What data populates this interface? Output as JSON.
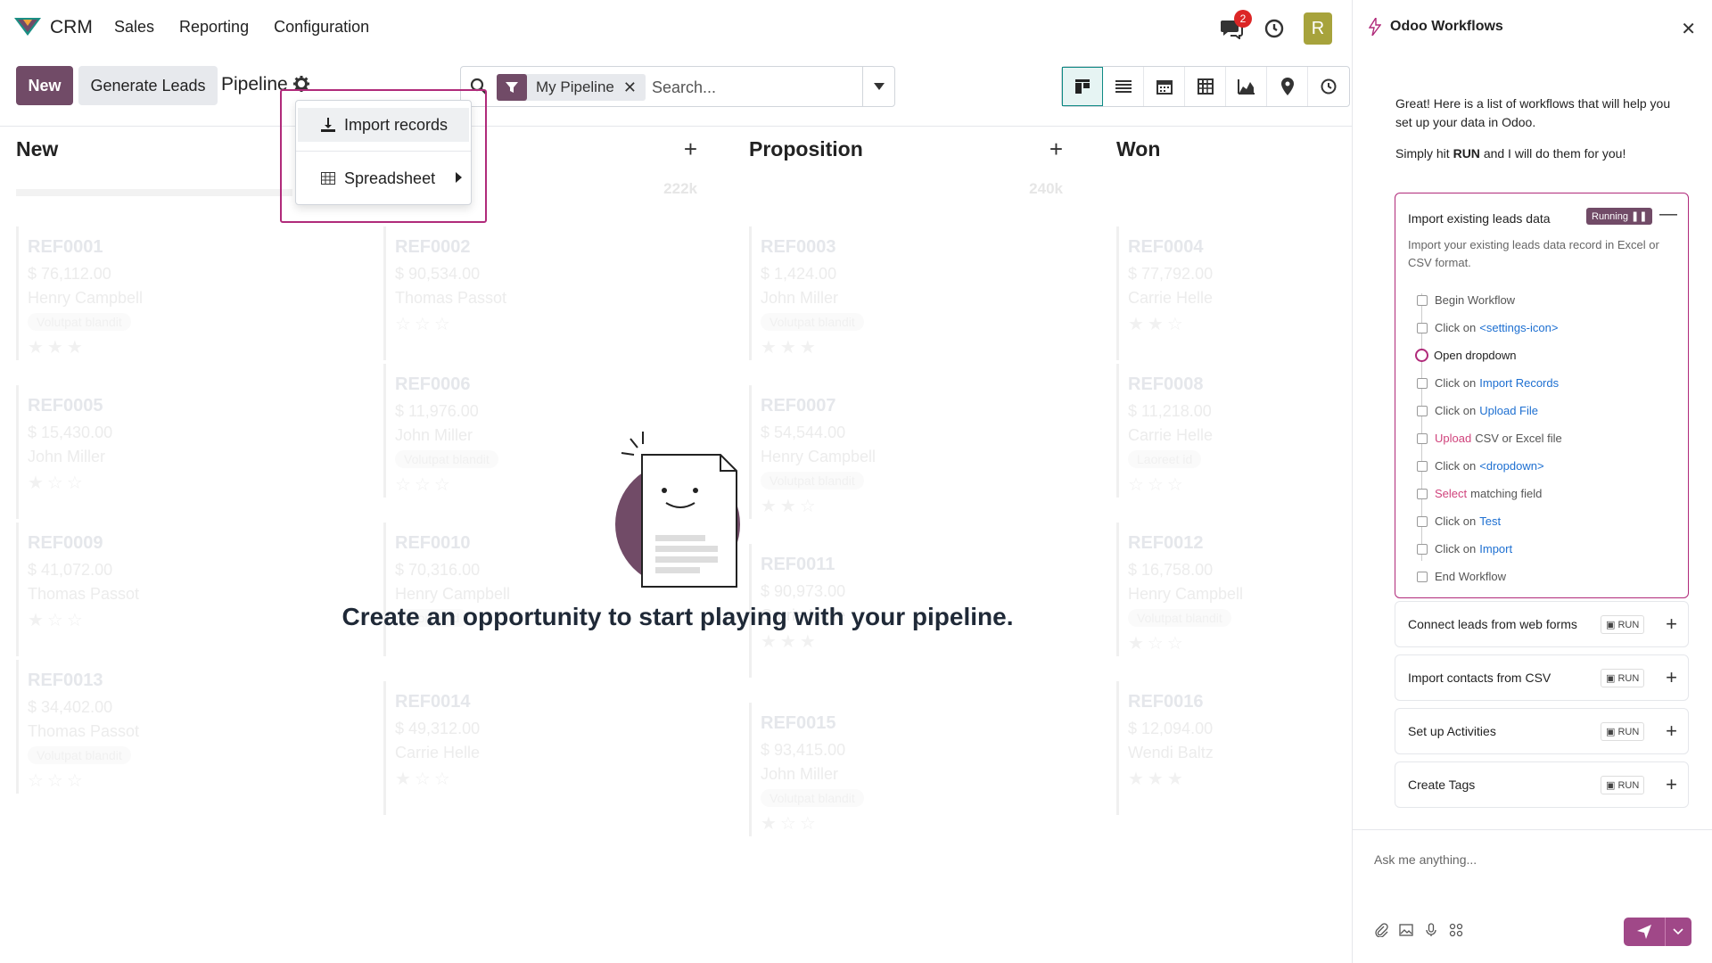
{
  "topbar": {
    "app_name": "CRM",
    "menu": [
      "Sales",
      "Reporting",
      "Configuration"
    ],
    "chat_badge": "2",
    "avatar_letter": "R"
  },
  "control": {
    "new_label": "New",
    "generate_label": "Generate Leads",
    "title": "Pipeline",
    "filter_facet": "My Pipeline",
    "search_placeholder": "Search..."
  },
  "dropdown": {
    "import_label": "Import records",
    "spreadsheet_label": "Spreadsheet"
  },
  "columns": [
    {
      "title": "New",
      "total": "",
      "cards": [
        {
          "ref": "REF0001",
          "amount": "$ 76,112.00",
          "name": "Henry Campbell",
          "tag": "Volutpat blandit",
          "stars": 3
        },
        {
          "ref": "REF0005",
          "amount": "$ 15,430.00",
          "name": "John Miller",
          "tag": "",
          "stars": 1
        },
        {
          "ref": "REF0009",
          "amount": "$ 41,072.00",
          "name": "Thomas Passot",
          "tag": "",
          "stars": 1
        },
        {
          "ref": "REF0013",
          "amount": "$ 34,402.00",
          "name": "Thomas Passot",
          "tag": "Volutpat blandit",
          "stars": 0
        }
      ]
    },
    {
      "title": "",
      "total": "222k",
      "cards": [
        {
          "ref": "REF0002",
          "amount": "$ 90,534.00",
          "name": "Thomas Passot",
          "tag": "",
          "stars": 0
        },
        {
          "ref": "REF0006",
          "amount": "$ 11,976.00",
          "name": "John Miller",
          "tag": "Volutpat blandit",
          "stars": 0
        },
        {
          "ref": "REF0010",
          "amount": "$ 70,316.00",
          "name": "Henry Campbell",
          "tag": "Laoreet id",
          "stars": 0
        },
        {
          "ref": "REF0014",
          "amount": "$ 49,312.00",
          "name": "Carrie Helle",
          "tag": "",
          "stars": 1
        }
      ]
    },
    {
      "title": "Proposition",
      "total": "240k",
      "cards": [
        {
          "ref": "REF0003",
          "amount": "$ 1,424.00",
          "name": "John Miller",
          "tag": "Volutpat blandit",
          "stars": 3
        },
        {
          "ref": "REF0007",
          "amount": "$ 54,544.00",
          "name": "Henry Campbell",
          "tag": "Volutpat blandit",
          "stars": 2
        },
        {
          "ref": "REF0011",
          "amount": "$ 90,973.00",
          "name": "Carrie Helle",
          "tag": "",
          "stars": 3
        },
        {
          "ref": "REF0015",
          "amount": "$ 93,415.00",
          "name": "John Miller",
          "tag": "Volutpat blandit",
          "stars": 1
        }
      ]
    },
    {
      "title": "Won",
      "total": "",
      "cards": [
        {
          "ref": "REF0004",
          "amount": "$ 77,792.00",
          "name": "Carrie Helle",
          "tag": "",
          "stars": 2
        },
        {
          "ref": "REF0008",
          "amount": "$ 11,218.00",
          "name": "Carrie Helle",
          "tag": "Laoreet id",
          "stars": 0
        },
        {
          "ref": "REF0012",
          "amount": "$ 16,758.00",
          "name": "Henry Campbell",
          "tag": "Volutpat blandit",
          "stars": 1
        },
        {
          "ref": "REF0016",
          "amount": "$ 12,094.00",
          "name": "Wendi Baltz",
          "tag": "",
          "stars": 3
        }
      ]
    }
  ],
  "empty_message": "Create an opportunity to start playing with your pipeline.",
  "panel": {
    "title": "Odoo Workflows",
    "intro": "Great! Here is a list of workflows that will help you set up your data in Odoo.",
    "intro2_pre": "Simply hit",
    "intro2_bold": "RUN",
    "intro2_post": "and I will do them for you!",
    "active_workflow": {
      "title": "Import existing leads data",
      "status": "Running",
      "description": "Import your existing leads data record in Excel or CSV format.",
      "steps": [
        {
          "pre": "Begin Workflow",
          "link": "",
          "action": "",
          "post": ""
        },
        {
          "pre": "Click on",
          "link": "<settings-icon>",
          "action": "",
          "post": ""
        },
        {
          "pre": "Open dropdown",
          "link": "",
          "action": "",
          "post": "",
          "current": true
        },
        {
          "pre": "Click on",
          "link": "Import Records",
          "action": "",
          "post": ""
        },
        {
          "pre": "Click on",
          "link": "Upload File",
          "action": "",
          "post": ""
        },
        {
          "pre": "",
          "link": "",
          "action": "Upload",
          "post": "CSV or Excel file"
        },
        {
          "pre": "Click on",
          "link": "<dropdown>",
          "action": "",
          "post": ""
        },
        {
          "pre": "",
          "link": "",
          "action": "Select",
          "post": "matching field"
        },
        {
          "pre": "Click on",
          "link": "Test",
          "action": "",
          "post": ""
        },
        {
          "pre": "Click on",
          "link": "Import",
          "action": "",
          "post": ""
        },
        {
          "pre": "End Workflow",
          "link": "",
          "action": "",
          "post": ""
        }
      ]
    },
    "workflows": [
      {
        "title": "Connect leads from web forms",
        "run": "RUN"
      },
      {
        "title": "Import contacts from CSV",
        "run": "RUN"
      },
      {
        "title": "Set up Activities",
        "run": "RUN"
      },
      {
        "title": "Create Tags",
        "run": "RUN"
      }
    ],
    "input_placeholder": "Ask me anything..."
  },
  "colors": {
    "brand": "#714b67",
    "highlight": "#b02a7a",
    "link": "#1d6fd1"
  }
}
